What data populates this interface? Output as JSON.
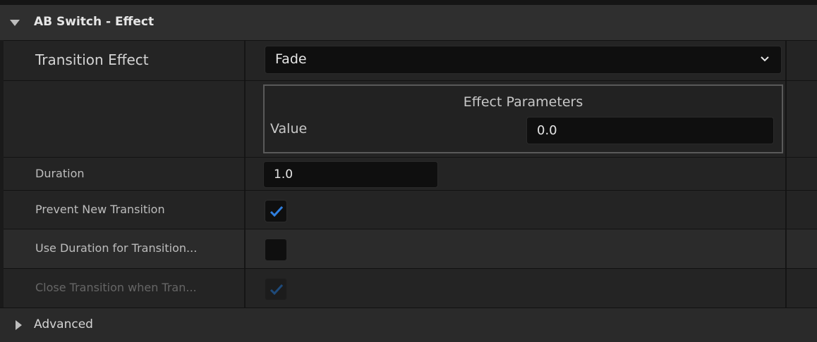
{
  "section": {
    "title": "AB Switch - Effect",
    "expanded": true
  },
  "properties": {
    "transition_effect": {
      "label": "Transition Effect",
      "value": "Fade"
    },
    "effect_parameters": {
      "title": "Effect Parameters",
      "value_label": "Value",
      "value": "0.0"
    },
    "duration": {
      "label": "Duration",
      "value": "1.0"
    },
    "prevent_new_transition": {
      "label": "Prevent New Transition",
      "checked": true
    },
    "use_duration_for_transition": {
      "label": "Use Duration for Transition...",
      "checked": false
    },
    "close_transition_when_tran": {
      "label": "Close Transition when Tran...",
      "checked": true,
      "disabled": true
    }
  },
  "advanced": {
    "title": "Advanced",
    "expanded": false
  },
  "colors": {
    "check_accent": "#2f7fe0",
    "check_disabled": "#1e4a7a"
  }
}
